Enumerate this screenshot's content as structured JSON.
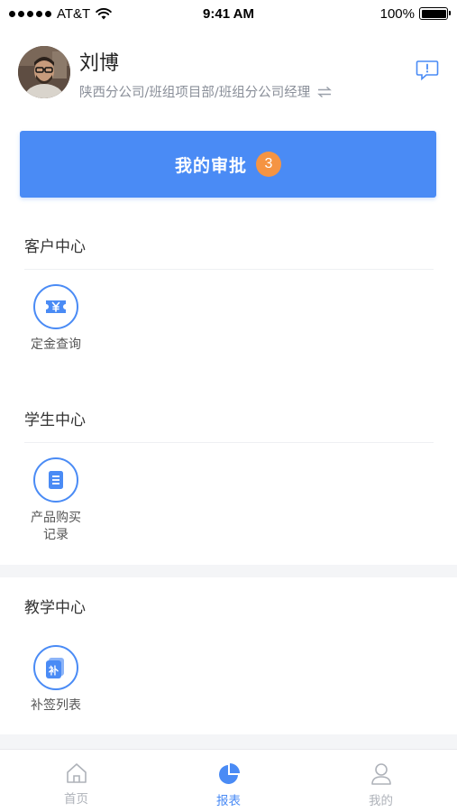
{
  "status_bar": {
    "carrier": "AT&T",
    "time": "9:41 AM",
    "battery": "100%",
    "battery_level": 1.0
  },
  "profile": {
    "name": "刘博",
    "org": "陕西分公司/班组项目部/班组分公司经理",
    "switch_icon": "swap-icon",
    "message_icon": "message-alert-icon"
  },
  "approval": {
    "label": "我的审批",
    "badge": "3"
  },
  "sections": {
    "customer": {
      "title": "客户中心",
      "items": [
        {
          "label": "定金查询",
          "icon": "ticket-yen-icon"
        }
      ]
    },
    "student": {
      "title": "学生中心",
      "items": [
        {
          "label": "产品购买记录",
          "icon": "document-icon"
        }
      ]
    },
    "teaching": {
      "title": "教学中心",
      "items": [
        {
          "label": "补签列表",
          "icon": "supplement-sign-icon"
        }
      ]
    }
  },
  "tabs": [
    {
      "label": "首页",
      "icon": "home-icon",
      "active": false
    },
    {
      "label": "报表",
      "icon": "pie-chart-icon",
      "active": true
    },
    {
      "label": "我的",
      "icon": "user-icon",
      "active": false
    }
  ],
  "colors": {
    "accent": "#4a8bf5",
    "badge": "#f59443",
    "inactive": "#aeb2b9",
    "band": "#f4f5f7"
  }
}
